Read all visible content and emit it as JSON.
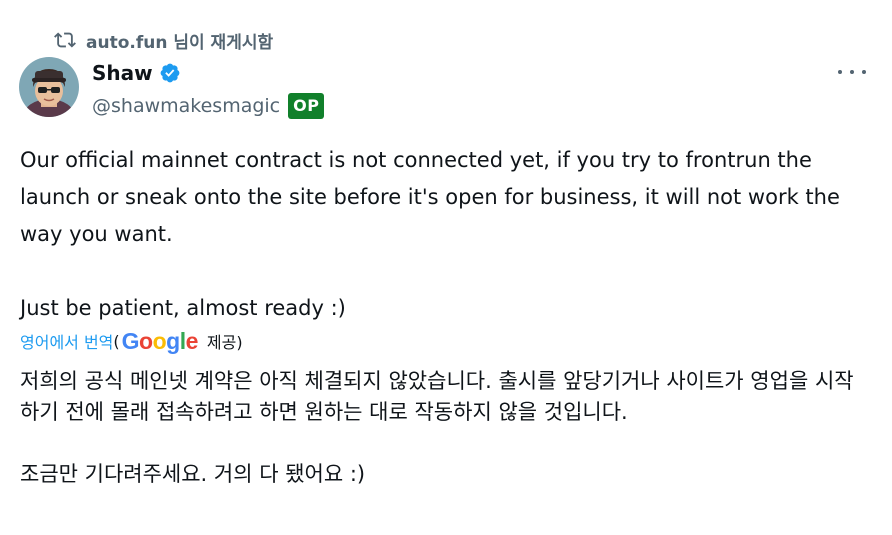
{
  "repost": {
    "icon": "repost-icon",
    "text": "auto.fun 님이 재게시함"
  },
  "author": {
    "avatar": "avatar-image",
    "name": "Shaw",
    "verified_icon": "verified-badge-icon",
    "handle": "@shawmakesmagic",
    "op_badge": "OP"
  },
  "more_menu": {
    "icon": "more-options-icon"
  },
  "post": {
    "paragraph1": "Our official mainnet contract is not connected yet, if you try to frontrun the launch or sneak onto the site before it's open for business, it will not work the way you want.",
    "paragraph2": "Just be patient, almost ready :)"
  },
  "translation": {
    "link_label": "영어에서 번역",
    "open_paren": "(",
    "google_letters": [
      "G",
      "o",
      "o",
      "g",
      "l",
      "e"
    ],
    "provided_label": "제공)",
    "paragraph1": "저희의 공식 메인넷 계약은 아직 체결되지 않았습니다. 출시를 앞당기거나 사이트가 영업을 시작하기 전에 몰래 접속하려고 하면 원하는 대로 작동하지 않을 것입니다.",
    "paragraph2": "조금만 기다려주세요. 거의 다 됐어요 :)"
  },
  "colors": {
    "accent": "#1d9bf0",
    "muted": "#536471",
    "op_badge": "#11802b",
    "google": [
      "#4285f4",
      "#ea4335",
      "#fbbc05",
      "#4285f4",
      "#34a853",
      "#ea4335"
    ]
  }
}
